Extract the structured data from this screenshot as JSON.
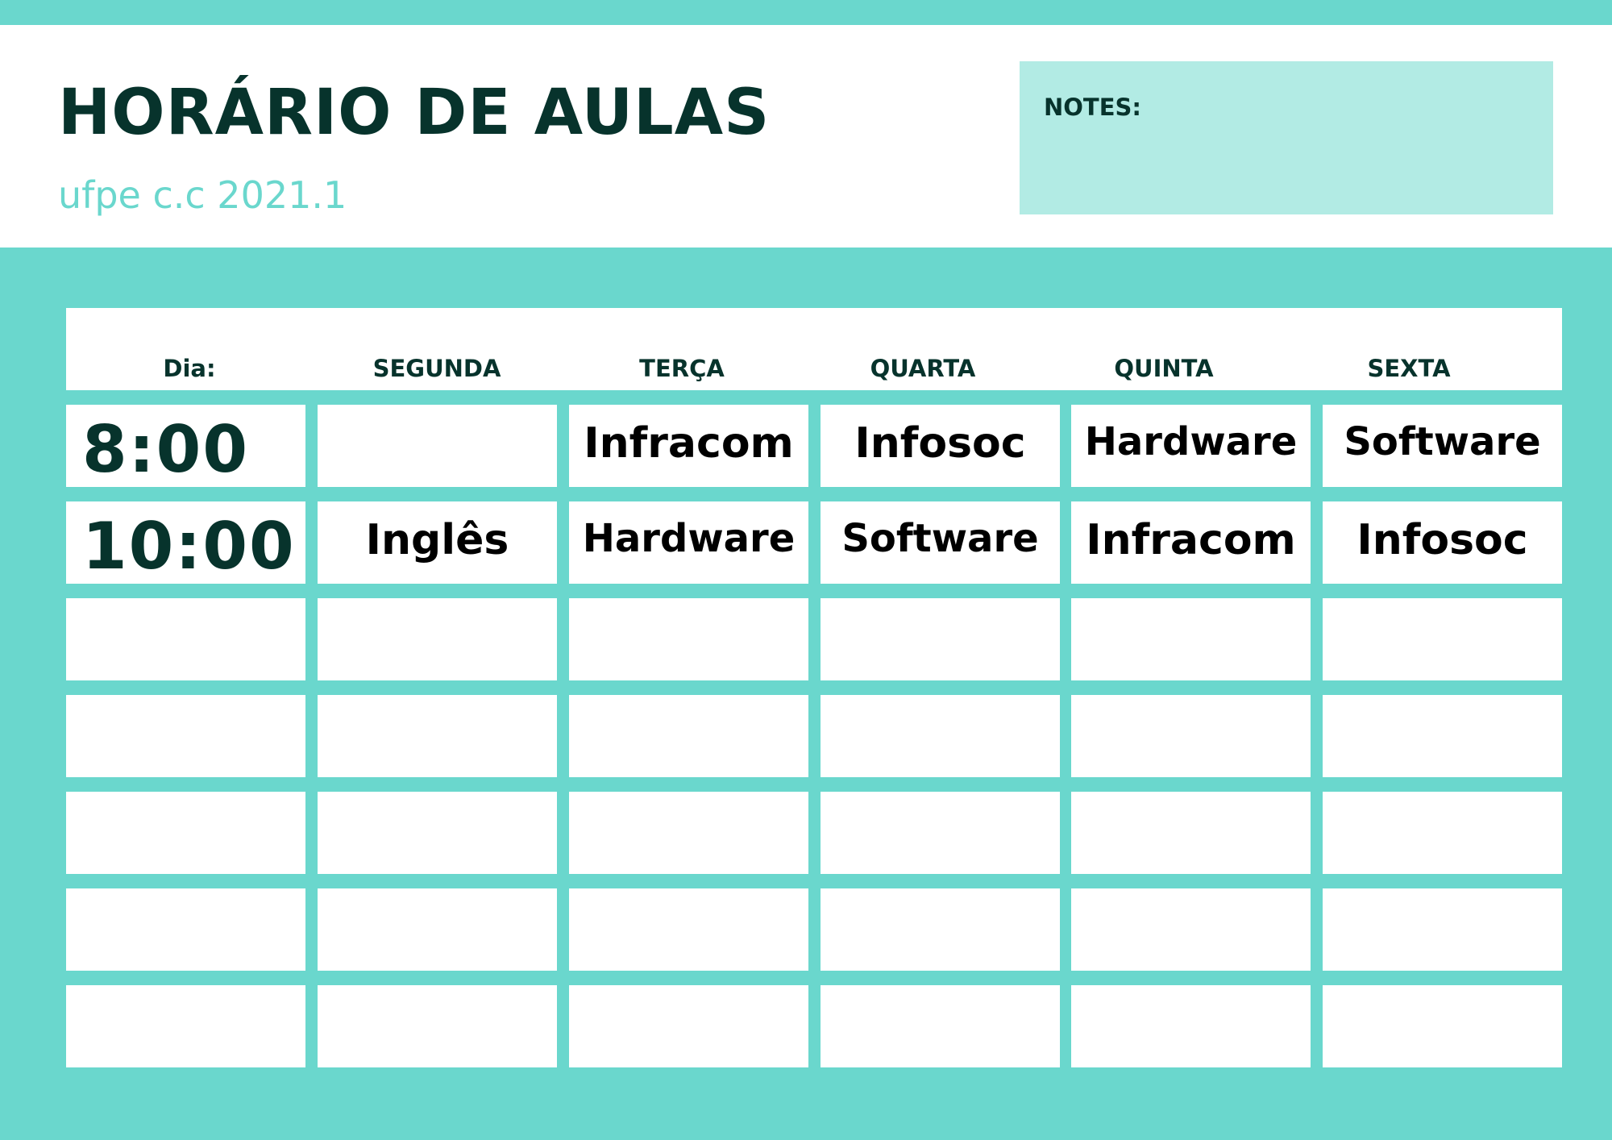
{
  "header": {
    "title": "HORÁRIO DE AULAS",
    "subtitle": "ufpe c.c 2021.1",
    "notes_label": "NOTES:"
  },
  "colors": {
    "accent": "#6ad7cd",
    "notes_bg": "#b2ebe4",
    "dark_text": "#07332c"
  },
  "schedule": {
    "columns": [
      "Dia:",
      "SEGUNDA",
      "TERÇA",
      "QUARTA",
      "QUINTA",
      "SEXTA"
    ],
    "rows": [
      {
        "time": "8:00",
        "cells": [
          "",
          "Infracom",
          "Infosoc",
          "Hardware",
          "Software"
        ]
      },
      {
        "time": "10:00",
        "cells": [
          "Inglês",
          "Hardware",
          "Software",
          "Infracom",
          "Infosoc"
        ]
      },
      {
        "time": "",
        "cells": [
          "",
          "",
          "",
          "",
          ""
        ]
      },
      {
        "time": "",
        "cells": [
          "",
          "",
          "",
          "",
          ""
        ]
      },
      {
        "time": "",
        "cells": [
          "",
          "",
          "",
          "",
          ""
        ]
      },
      {
        "time": "",
        "cells": [
          "",
          "",
          "",
          "",
          ""
        ]
      },
      {
        "time": "",
        "cells": [
          "",
          "",
          "",
          "",
          ""
        ]
      }
    ]
  }
}
